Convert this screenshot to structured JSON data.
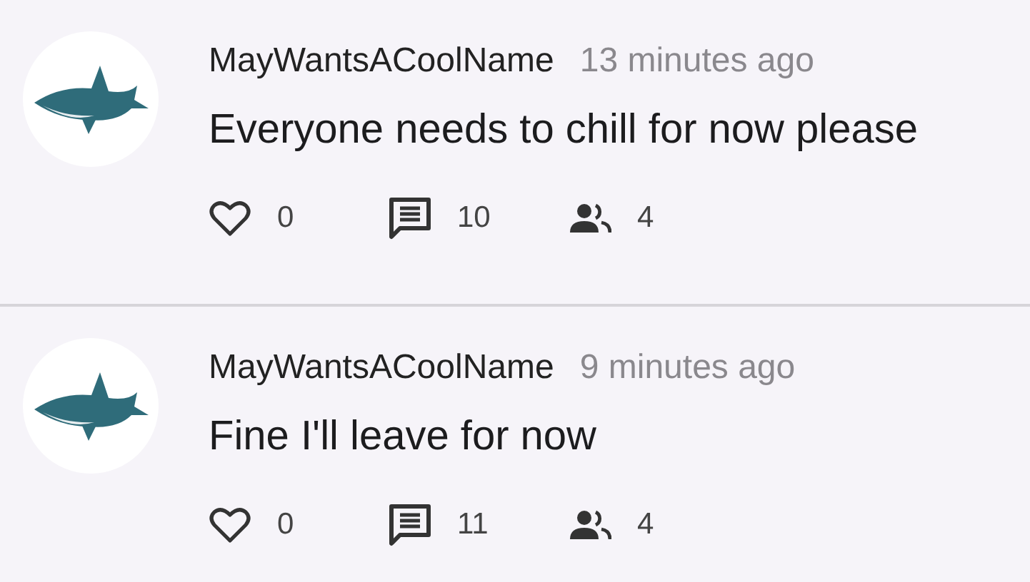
{
  "posts": [
    {
      "author": "MayWantsACoolName",
      "time": "13 minutes ago",
      "text": "Everyone needs to chill for now please",
      "likes": "0",
      "comments": "10",
      "participants": "4"
    },
    {
      "author": "MayWantsACoolName",
      "time": "9 minutes ago",
      "text": "Fine I'll leave for now",
      "likes": "0",
      "comments": "11",
      "participants": "4"
    }
  ]
}
